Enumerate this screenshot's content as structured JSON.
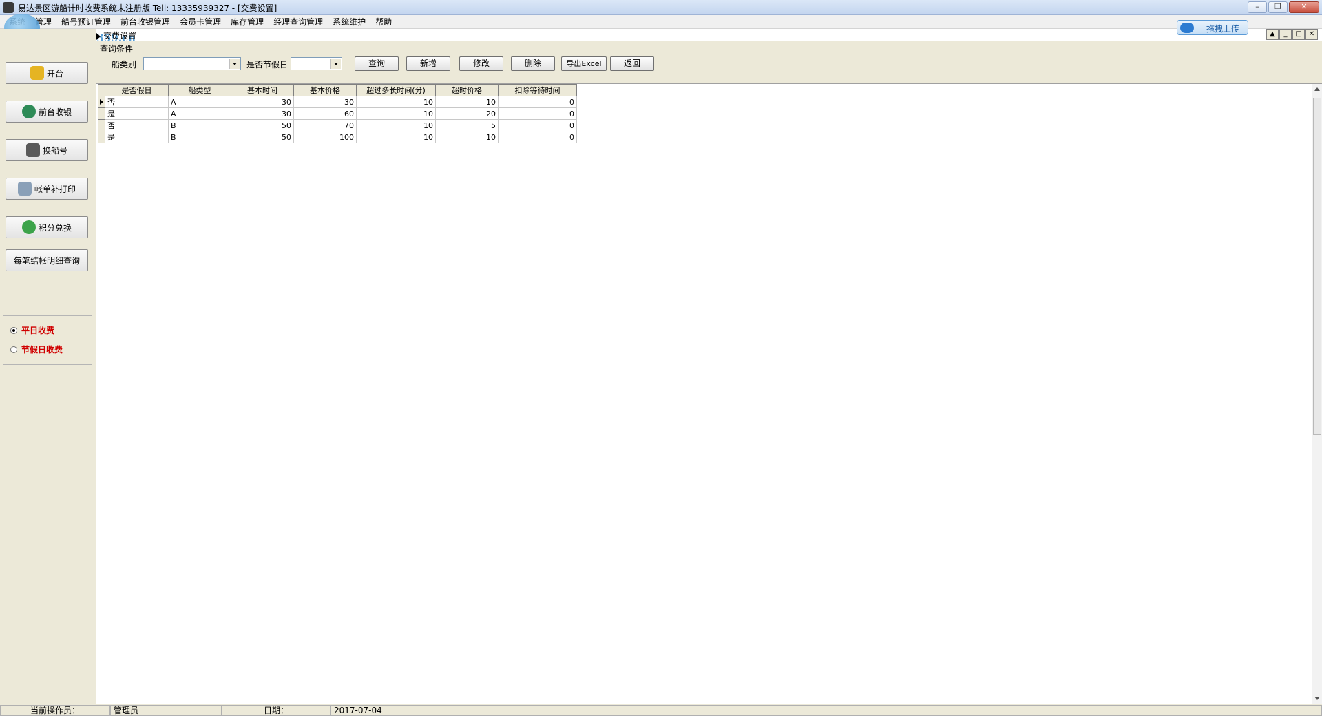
{
  "window": {
    "title": "易达景区游船计时收费系统未注册版 Tell: 13335939327 - [交费设置]"
  },
  "menu": [
    "系统",
    "管理",
    "船号预订管理",
    "前台收银管理",
    "会员卡管理",
    "库存管理",
    "经理查询管理",
    "系统维护",
    "帮助"
  ],
  "watermark": {
    "url": "www.pc0359.cn"
  },
  "upload_button": {
    "label": "拖拽上传"
  },
  "mdi_tab": {
    "label": "交费设置"
  },
  "sidebar": {
    "buttons": [
      {
        "label": "开台",
        "icon": "open-table-icon"
      },
      {
        "label": "前台收银",
        "icon": "cash-bag-icon"
      },
      {
        "label": "换船号",
        "icon": "swap-boat-icon"
      },
      {
        "label": "帐单补打印",
        "icon": "printer-icon"
      },
      {
        "label": "积分兑换",
        "icon": "points-icon"
      },
      {
        "label": "每笔结帐明细查询",
        "icon": ""
      }
    ],
    "fee_mode": {
      "options": [
        "平日收费",
        "节假日收费"
      ],
      "selected": "平日收费"
    }
  },
  "query": {
    "section_label": "查询条件",
    "boat_type_label": "船类别",
    "boat_type_value": "",
    "holiday_label": "是否节假日",
    "holiday_value": "",
    "buttons": [
      "查询",
      "新增",
      "修改",
      "删除",
      "导出Excel",
      "返回"
    ]
  },
  "grid": {
    "columns": [
      "是否假日",
      "船类型",
      "基本时间",
      "基本价格",
      "超过多长时间(分)",
      "超时价格",
      "扣除等待时间"
    ],
    "rows": [
      [
        "否",
        "A",
        "30",
        "30",
        "10",
        "10",
        "0"
      ],
      [
        "是",
        "A",
        "30",
        "60",
        "10",
        "20",
        "0"
      ],
      [
        "否",
        "B",
        "50",
        "70",
        "10",
        "5",
        "0"
      ],
      [
        "是",
        "B",
        "50",
        "100",
        "10",
        "10",
        "0"
      ]
    ],
    "current_row": 0
  },
  "status": {
    "operator_label": "当前操作员：",
    "operator_value": "管理员",
    "date_label": "日期：",
    "date_value": "2017-07-04"
  },
  "colors": {
    "accent_red": "#d00000",
    "panel_bg": "#ece9d8"
  }
}
